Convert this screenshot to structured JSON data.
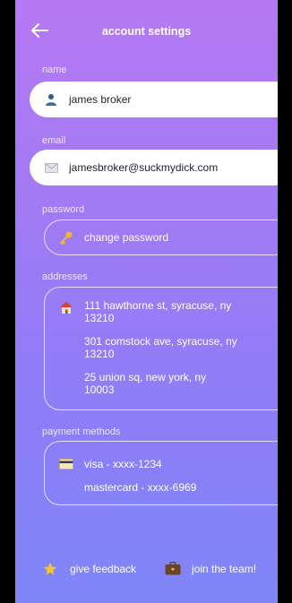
{
  "header": {
    "title": "account settings",
    "back_icon": "arrow-left-icon"
  },
  "name": {
    "label": "name",
    "value": "james broker",
    "icon": "person-icon"
  },
  "email": {
    "label": "email",
    "value": "jamesbroker@suckmydick.com",
    "icon": "envelope-icon"
  },
  "password": {
    "label": "password",
    "action": "change password",
    "icon": "key-icon"
  },
  "addresses": {
    "label": "addresses",
    "icon": "house-icon",
    "items": [
      {
        "line1": "111 hawthorne st, syracuse, ny",
        "line2": "13210"
      },
      {
        "line1": "301 comstock ave, syracuse, ny",
        "line2": "13210"
      },
      {
        "line1": "25 union sq, new york, ny",
        "line2": "10003"
      }
    ]
  },
  "payment": {
    "label": "payment methods",
    "icon": "credit-card-icon",
    "items": [
      "visa - xxxx-1234",
      "mastercard - xxxx-6969"
    ]
  },
  "footer": {
    "feedback": "give feedback",
    "feedback_icon": "star-icon",
    "join": "join the team!",
    "join_icon": "briefcase-icon"
  },
  "colors": {
    "gradient_top": "#b679f3",
    "gradient_bottom": "#7f86f8",
    "field_bg": "#ffffff"
  }
}
